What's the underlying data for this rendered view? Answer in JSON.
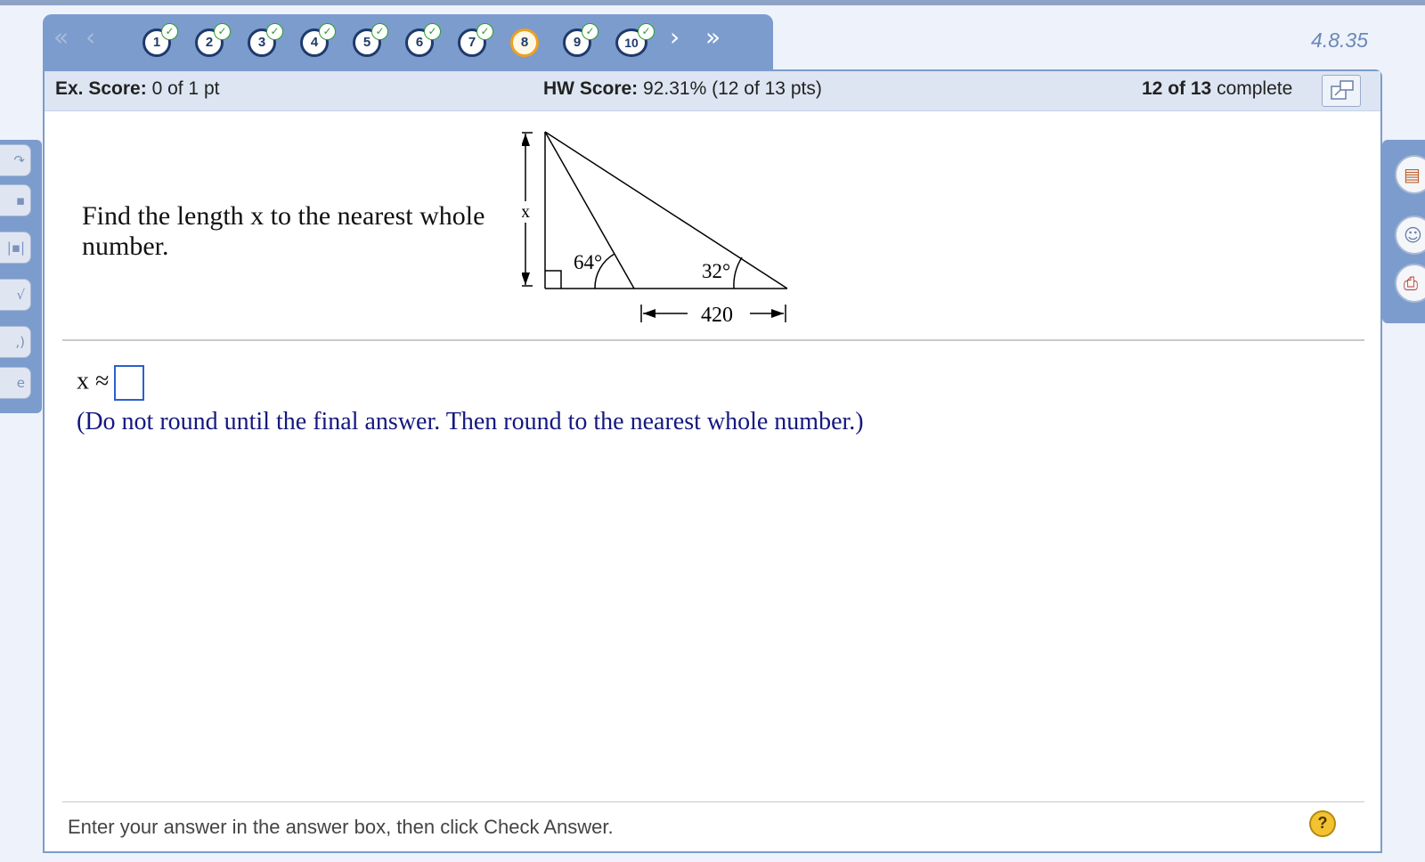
{
  "nav": {
    "first": "«",
    "prev": "‹",
    "next": "›",
    "last": "»",
    "questions": [
      {
        "label": "1",
        "status": "done"
      },
      {
        "label": "2",
        "status": "done"
      },
      {
        "label": "3",
        "status": "done"
      },
      {
        "label": "4",
        "status": "done"
      },
      {
        "label": "5",
        "status": "done"
      },
      {
        "label": "6",
        "status": "done"
      },
      {
        "label": "7",
        "status": "done"
      },
      {
        "label": "8",
        "status": "current"
      },
      {
        "label": "9",
        "status": "done"
      },
      {
        "label": "10",
        "status": "done"
      }
    ],
    "check_glyph": "✓",
    "version": "4.8.35"
  },
  "score": {
    "ex_label": "Ex. Score:",
    "ex_value": "0 of 1 pt",
    "hw_label": "HW Score:",
    "hw_value": "92.31% (12 of 13 pts)",
    "complete_count": "12 of 13",
    "complete_label": "complete"
  },
  "question": {
    "text": "Find the length x to the nearest whole number.",
    "figure": {
      "height_label": "x",
      "angle_left": "64°",
      "angle_right": "32°",
      "base_label": "420"
    },
    "answer_prefix": "x ≈",
    "answer_value": "",
    "hint": "(Do not round until the final answer. Then round to the nearest whole number.)"
  },
  "footer": {
    "instruction": "Enter your answer in the answer box, then click Check Answer.",
    "help": "?"
  },
  "colors": {
    "nav_blue": "#7b9ccd",
    "current_ring": "#f0a020",
    "check_green": "#2e9c2e",
    "hint_text": "#141880"
  }
}
